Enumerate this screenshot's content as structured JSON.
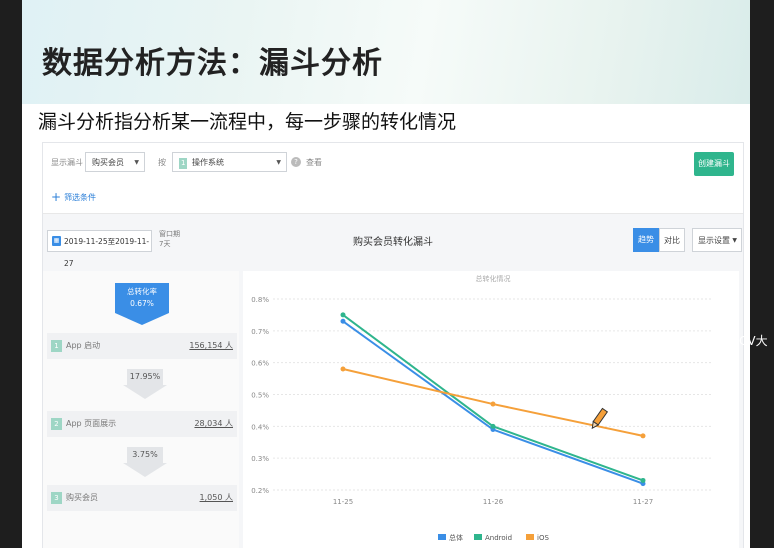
{
  "slide": {
    "title": "数据分析方法：漏斗分析",
    "subtitle": "漏斗分析指分析某一流程中，每一步骤的转化情况"
  },
  "app": {
    "show_funnel_label": "显示漏斗",
    "funnel_select": "购买会员",
    "by_label": "按",
    "dimension_tag": "1",
    "dimension_select": "操作系统",
    "view_label": "查看",
    "create_button": "创建漏斗",
    "filter_add": "筛选条件",
    "date_range": "2019-11-25至2019-11-27",
    "window_label": "窗口期",
    "window_value": "7天",
    "chart_header": "购买会员转化漏斗",
    "tab_trend": "趋势",
    "tab_compare": "对比",
    "display_settings": "显示设置"
  },
  "funnel": {
    "total_rate_label": "总转化率",
    "total_rate_value": "0.67%",
    "steps": [
      {
        "num": "1",
        "name": "App 启动",
        "value": "156,154 人"
      },
      {
        "num": "2",
        "name": "App 页面展示",
        "value": "28,034 人"
      },
      {
        "num": "3",
        "name": "购买会员",
        "value": "1,050 人"
      }
    ],
    "step_rates": [
      "17.95%",
      "3.75%"
    ]
  },
  "colors": {
    "total": "#3a8ee6",
    "android": "#2fb58d",
    "ios": "#f5a03a"
  },
  "chart_data": {
    "type": "line",
    "title": "总转化情况",
    "categories": [
      "11-25",
      "11-26",
      "11-27"
    ],
    "y_ticks": [
      "0.8%",
      "0.7%",
      "0.6%",
      "0.5%",
      "0.4%",
      "0.3%",
      "0.2%"
    ],
    "ylim": [
      0.2,
      0.8
    ],
    "grid": true,
    "legend_position": "bottom",
    "series": [
      {
        "name": "总体",
        "values": [
          0.73,
          0.39,
          0.22
        ],
        "color": "#3a8ee6"
      },
      {
        "name": "Android",
        "values": [
          0.75,
          0.4,
          0.23
        ],
        "color": "#2fb58d"
      },
      {
        "name": "iOS",
        "values": [
          0.58,
          0.47,
          0.37
        ],
        "color": "#f5a03a"
      }
    ]
  },
  "watermark": "CV大"
}
